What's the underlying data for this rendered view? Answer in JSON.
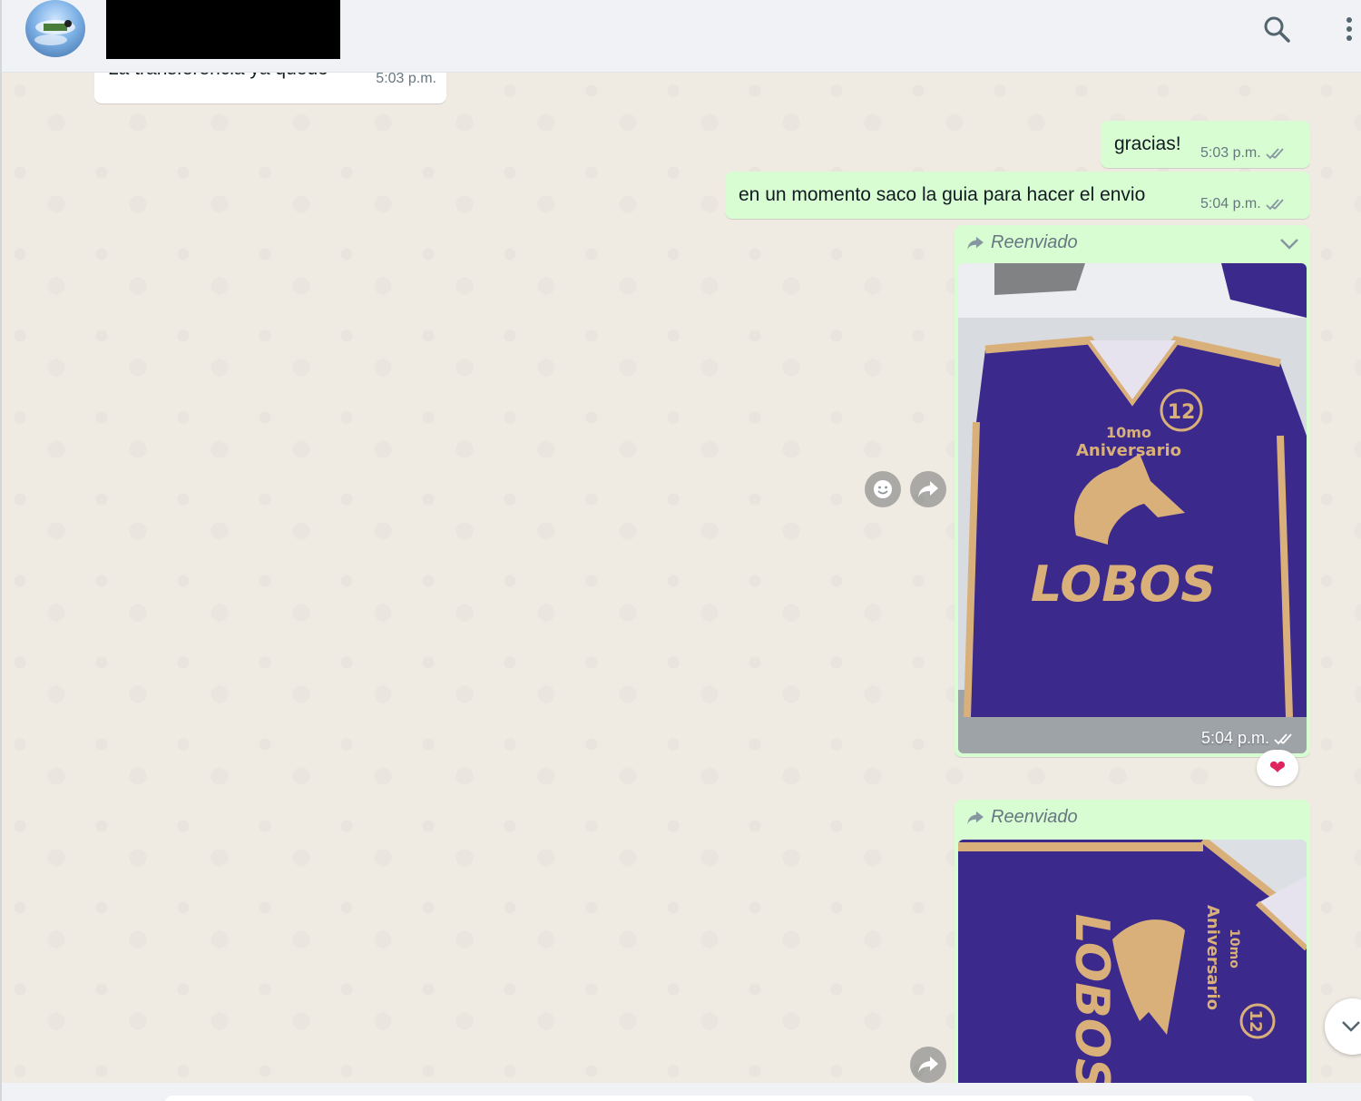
{
  "header": {
    "avatar_icon": "contact-avatar",
    "search_icon": "search-icon",
    "menu_icon": "more-vertical-icon"
  },
  "messages": {
    "incoming_1": {
      "text": "La transferencia ya quedó",
      "time": "5:03 p.m."
    },
    "outgoing_1": {
      "text": "gracias!",
      "time": "5:03 p.m."
    },
    "outgoing_2": {
      "text": "en un momento saco la guia para hacer el envio",
      "time": "5:04 p.m."
    },
    "forwarded_1": {
      "label": "Reenviado",
      "time": "5:04 p.m.",
      "reaction": "❤"
    },
    "forwarded_2": {
      "label": "Reenviado"
    }
  },
  "jersey_1": {
    "badge": "12",
    "line1": "10mo",
    "line2": "Aniversario",
    "team": "LOBOS"
  },
  "jersey_2": {
    "badge": "12",
    "line1": "10mo",
    "line2": "Aniversario",
    "team": "LOBOS"
  },
  "colors": {
    "outgoing_bubble": "#d9fdd3",
    "incoming_bubble": "#ffffff",
    "chat_bg": "#efeae2",
    "jersey_purple": "#3b2a8c",
    "jersey_gold": "#d9b07a",
    "read_ticks": "#8696a0"
  }
}
